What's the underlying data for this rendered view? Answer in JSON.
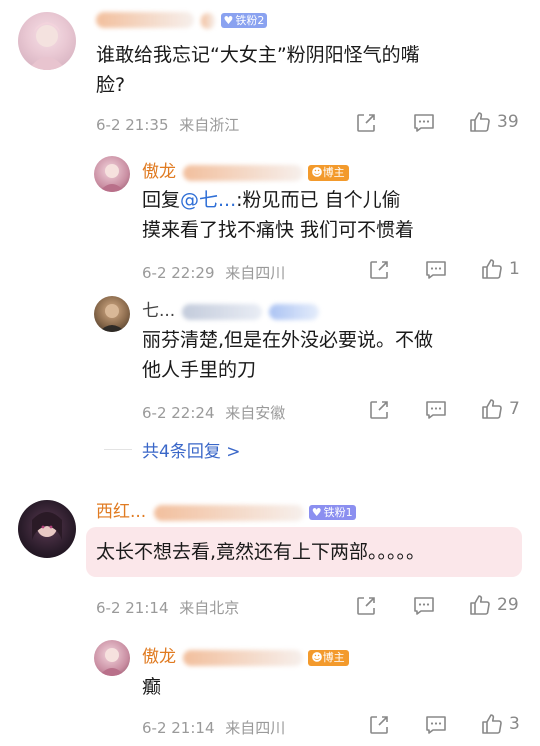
{
  "comments": [
    {
      "name": "...",
      "fan_badge": "铁粉2",
      "text_line1": "谁敢给我忘记“大女主”粉阴阳怪气的嘴",
      "text_line2": "脸?",
      "date_time": "6-2 21:35",
      "location": "来自浙江",
      "likes": "39"
    },
    {
      "name": "西红...",
      "fan_badge": "铁粉1",
      "text": "太长不想去看,竟然还有上下两部。。。。。",
      "date_time": "6-2 21:14",
      "location": "来自北京",
      "likes": "29"
    }
  ],
  "replies": [
    {
      "name": "傲龙",
      "blogger_badge": "博主",
      "reply_prefix": "回复",
      "mention": "@七...",
      "text_line1_rest": ":粉见而已 自个儿偷",
      "text_line2": "摸来看了找不痛快 我们可不惯着",
      "date_time": "6-2 22:29",
      "location": "来自四川",
      "likes": "1"
    },
    {
      "name": "七...",
      "text_line1": "丽芬清楚,但是在外没必要说。不做",
      "text_line2": "他人手里的刀",
      "date_time": "6-2 22:24",
      "location": "来自安徽",
      "likes": "7"
    },
    {
      "name": "傲龙",
      "blogger_badge": "博主",
      "text": "癫",
      "date_time": "6-2 21:14",
      "location": "来自四川",
      "likes": "3"
    }
  ],
  "more_replies": "共4条回复 >",
  "icons": [
    "share-icon",
    "comment-icon",
    "like-icon",
    "chevron-right-icon"
  ],
  "colors": {
    "name": "#e07b22",
    "link": "#3a67c8",
    "meta": "#9a9a9a"
  }
}
